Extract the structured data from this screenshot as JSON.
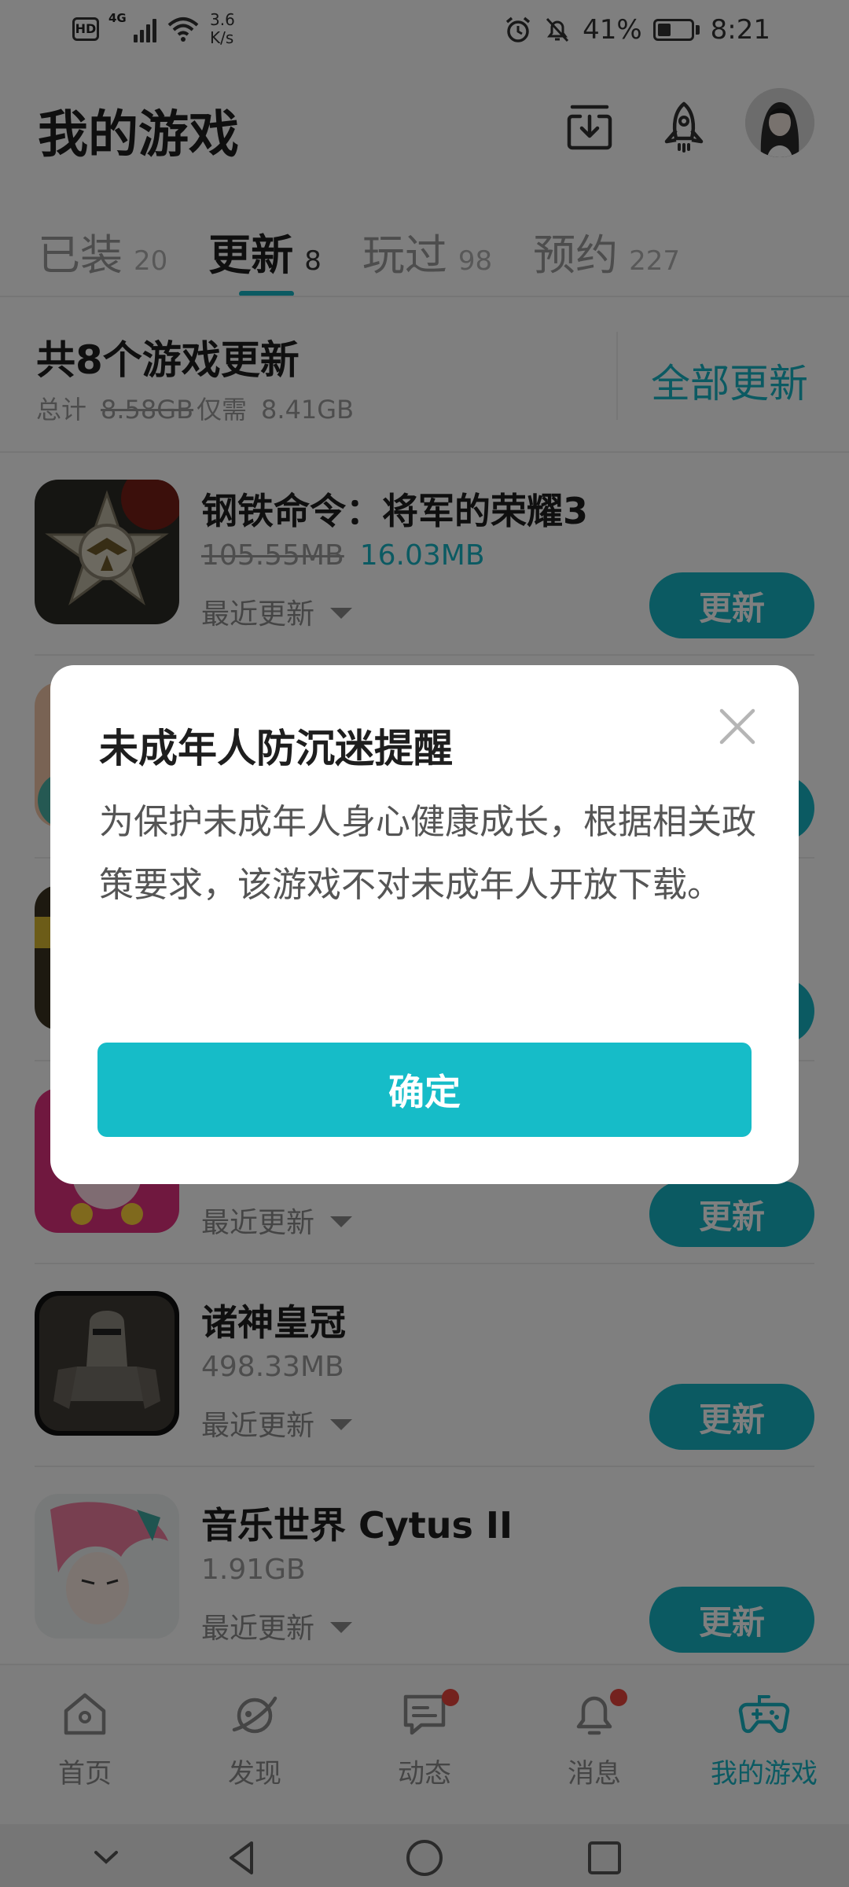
{
  "status_bar": {
    "hd": "HD",
    "network": "4G",
    "speed_value": "3.6",
    "speed_unit": "K/s",
    "battery": "41%",
    "battery_level": 0.41,
    "time": "8:21"
  },
  "header": {
    "title": "我的游戏",
    "icons": [
      "download-manager-icon",
      "rocket-icon"
    ]
  },
  "tabs": [
    {
      "label": "已装",
      "count": "20",
      "active": false
    },
    {
      "label": "更新",
      "count": "8",
      "active": true
    },
    {
      "label": "玩过",
      "count": "98",
      "active": false
    },
    {
      "label": "预约",
      "count": "227",
      "active": false
    }
  ],
  "summary": {
    "title": "共8个游戏更新",
    "total_label": "总计",
    "original_size": "8.58GB",
    "need_label": "仅需",
    "need_size": "8.41GB",
    "update_all": "全部更新"
  },
  "games": [
    {
      "name": "钢铁命令：将军的荣耀3",
      "old_size": "105.55MB",
      "new_size": "16.03MB",
      "recent": "最近更新",
      "button": "更新"
    },
    {
      "name": "诸神皇冠",
      "old_size": "498.33MB",
      "new_size": "",
      "recent": "最近更新",
      "button": "更新"
    },
    {
      "name": "音乐世界 Cytus II",
      "old_size": "1.91GB",
      "new_size": "",
      "recent": "最近更新",
      "button": "更新"
    }
  ],
  "partial_rows": {
    "recent": "最近更新",
    "button": "更新"
  },
  "bottom_nav": [
    {
      "label": "首页",
      "icon": "home-icon",
      "active": false,
      "badge": false
    },
    {
      "label": "发现",
      "icon": "planet-icon",
      "active": false,
      "badge": false
    },
    {
      "label": "动态",
      "icon": "chat-icon",
      "active": false,
      "badge": true
    },
    {
      "label": "消息",
      "icon": "bell-icon",
      "active": false,
      "badge": true
    },
    {
      "label": "我的游戏",
      "icon": "gamepad-icon",
      "active": true,
      "badge": false
    }
  ],
  "dialog": {
    "title": "未成年人防沉迷提醒",
    "body": "为保护未成年人身心健康成长，根据相关政策要求，该游戏不对未成年人开放下载。",
    "confirm": "确定"
  },
  "colors": {
    "accent": "#16b5c5",
    "badge": "#e8453c",
    "overlay": "rgba(0,0,0,0.5)"
  }
}
